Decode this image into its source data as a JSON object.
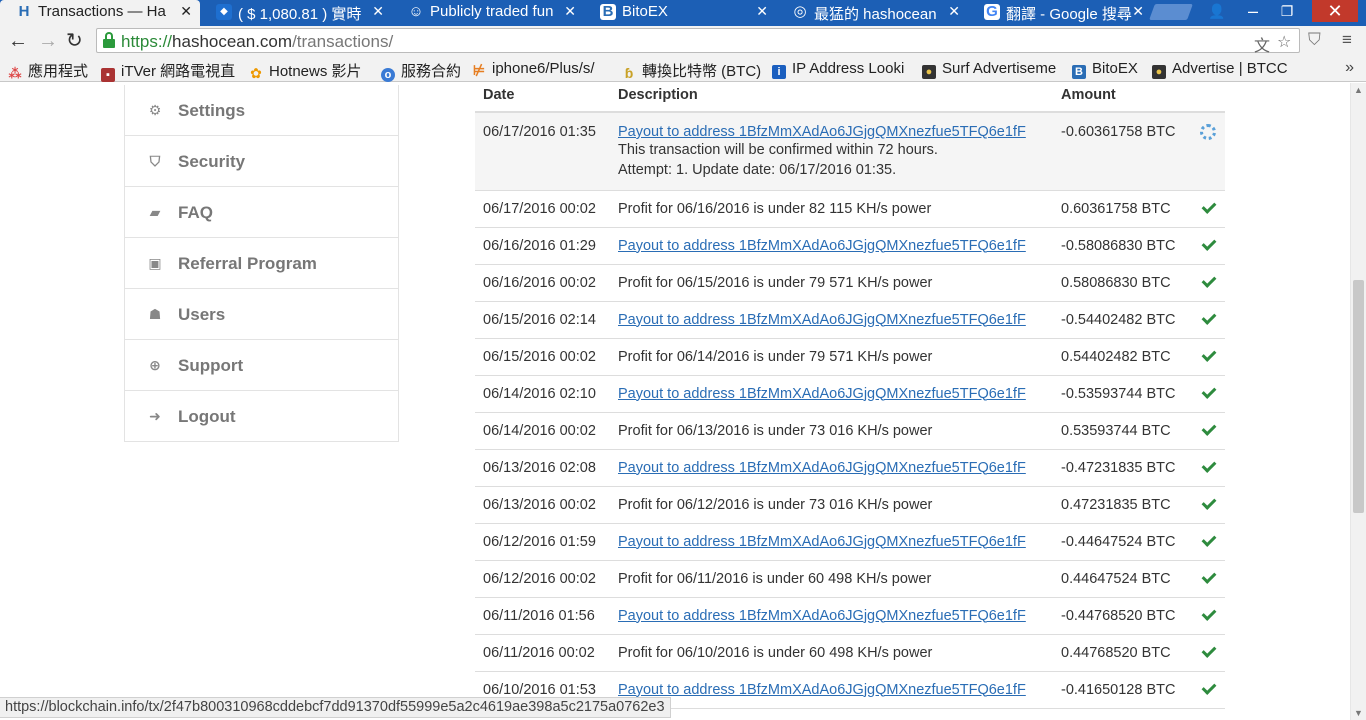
{
  "browser": {
    "tabs": [
      {
        "title": "Transactions — Ha",
        "favicon": "H",
        "favicon_color": "#2a6db5"
      },
      {
        "title": "( $ 1,080.81 ) 實時",
        "favicon": "cube",
        "favicon_color": "#1e6fd0"
      },
      {
        "title": "Publicly traded fun",
        "favicon": "reddit",
        "favicon_color": "#666"
      },
      {
        "title": "BitoEX",
        "favicon": "B",
        "favicon_color": "#2a6db5"
      },
      {
        "title": "最猛的 hashocean",
        "favicon": "chat",
        "favicon_color": "#888"
      },
      {
        "title": "翻譯 - Google 搜尋",
        "favicon": "G",
        "favicon_color": "#4285f4"
      }
    ],
    "url": {
      "protocol": "https://",
      "host": "hashocean.com",
      "path": "/transactions/"
    },
    "bookmarks": [
      {
        "label": "應用程式",
        "icon": "apps-icon",
        "color": "#d44"
      },
      {
        "label": "iTVer 網路電視直",
        "icon": "tv-icon",
        "color": "#a33"
      },
      {
        "label": "Hotnews 影片",
        "icon": "flower-icon",
        "color": "#e90"
      },
      {
        "label": "服務合約",
        "icon": "globe-icon",
        "color": "#3a7bd5"
      },
      {
        "label": "iphone6/Plus/s/",
        "icon": "cart-icon",
        "color": "#e67e22"
      },
      {
        "label": "轉換比特幣 (BTC)",
        "icon": "bitcoin-icon",
        "color": "#c9a227"
      },
      {
        "label": "IP Address Looki",
        "icon": "ip-icon",
        "color": "#1b5fbf"
      },
      {
        "label": "Surf Advertiseme",
        "icon": "surf-icon",
        "color": "#333"
      },
      {
        "label": "BitoEX",
        "icon": "bitoex-icon",
        "color": "#2a6db5"
      },
      {
        "label": "Advertise | BTCC",
        "icon": "btcc-icon",
        "color": "#333"
      }
    ],
    "bookmarks_more": "»"
  },
  "sidebar": {
    "items": [
      {
        "label": "Settings",
        "icon": "gear-icon"
      },
      {
        "label": "Security",
        "icon": "shield-icon"
      },
      {
        "label": "FAQ",
        "icon": "book-icon"
      },
      {
        "label": "Referral Program",
        "icon": "money-icon"
      },
      {
        "label": "Users",
        "icon": "users-icon"
      },
      {
        "label": "Support",
        "icon": "lifebuoy-icon"
      },
      {
        "label": "Logout",
        "icon": "signout-icon"
      }
    ]
  },
  "table": {
    "headers": {
      "date": "Date",
      "description": "Description",
      "amount": "Amount"
    },
    "rows": [
      {
        "date": "06/17/2016 01:35",
        "description": "Payout to address 1BfzMmXAdAo6JGjgQMXnezfue5TFQ6e1fF",
        "link": true,
        "amount": "-0.60361758 BTC",
        "status": "pending",
        "notes": [
          "This transaction will be confirmed within 72 hours.",
          "Attempt: 1. Update date: 06/17/2016 01:35."
        ]
      },
      {
        "date": "06/17/2016 00:02",
        "description": "Profit for 06/16/2016 is under 82 115 KH/s power",
        "link": false,
        "amount": "0.60361758 BTC",
        "status": "confirmed"
      },
      {
        "date": "06/16/2016 01:29",
        "description": "Payout to address 1BfzMmXAdAo6JGjgQMXnezfue5TFQ6e1fF",
        "link": true,
        "amount": "-0.58086830 BTC",
        "status": "confirmed"
      },
      {
        "date": "06/16/2016 00:02",
        "description": "Profit for 06/15/2016 is under 79 571 KH/s power",
        "link": false,
        "amount": "0.58086830 BTC",
        "status": "confirmed"
      },
      {
        "date": "06/15/2016 02:14",
        "description": "Payout to address 1BfzMmXAdAo6JGjgQMXnezfue5TFQ6e1fF",
        "link": true,
        "amount": "-0.54402482 BTC",
        "status": "confirmed"
      },
      {
        "date": "06/15/2016 00:02",
        "description": "Profit for 06/14/2016 is under 79 571 KH/s power",
        "link": false,
        "amount": "0.54402482 BTC",
        "status": "confirmed"
      },
      {
        "date": "06/14/2016 02:10",
        "description": "Payout to address 1BfzMmXAdAo6JGjgQMXnezfue5TFQ6e1fF",
        "link": true,
        "amount": "-0.53593744 BTC",
        "status": "confirmed"
      },
      {
        "date": "06/14/2016 00:02",
        "description": "Profit for 06/13/2016 is under 73 016 KH/s power",
        "link": false,
        "amount": "0.53593744 BTC",
        "status": "confirmed"
      },
      {
        "date": "06/13/2016 02:08",
        "description": "Payout to address 1BfzMmXAdAo6JGjgQMXnezfue5TFQ6e1fF",
        "link": true,
        "amount": "-0.47231835 BTC",
        "status": "confirmed"
      },
      {
        "date": "06/13/2016 00:02",
        "description": "Profit for 06/12/2016 is under 73 016 KH/s power",
        "link": false,
        "amount": "0.47231835 BTC",
        "status": "confirmed"
      },
      {
        "date": "06/12/2016 01:59",
        "description": "Payout to address 1BfzMmXAdAo6JGjgQMXnezfue5TFQ6e1fF",
        "link": true,
        "amount": "-0.44647524 BTC",
        "status": "confirmed"
      },
      {
        "date": "06/12/2016 00:02",
        "description": "Profit for 06/11/2016 is under 60 498 KH/s power",
        "link": false,
        "amount": "0.44647524 BTC",
        "status": "confirmed"
      },
      {
        "date": "06/11/2016 01:56",
        "description": "Payout to address 1BfzMmXAdAo6JGjgQMXnezfue5TFQ6e1fF",
        "link": true,
        "amount": "-0.44768520 BTC",
        "status": "confirmed"
      },
      {
        "date": "06/11/2016 00:02",
        "description": "Profit for 06/10/2016 is under 60 498 KH/s power",
        "link": false,
        "amount": "0.44768520 BTC",
        "status": "confirmed"
      },
      {
        "date": "06/10/2016 01:53",
        "description": "Payout to address 1BfzMmXAdAo6JGjgQMXnezfue5TFQ6e1fF",
        "link": true,
        "amount": "-0.41650128 BTC",
        "status": "confirmed"
      }
    ]
  },
  "statusbar": {
    "text": "https://blockchain.info/tx/2f47b800310968cddebcf7dd91370df55999e5a2c4619ae398a5c2175a0762e3"
  },
  "colors": {
    "link": "#2a6db5",
    "check": "#2e8b3e",
    "tabstrip": "#1c5fb5",
    "secure": "#2b8a38"
  }
}
